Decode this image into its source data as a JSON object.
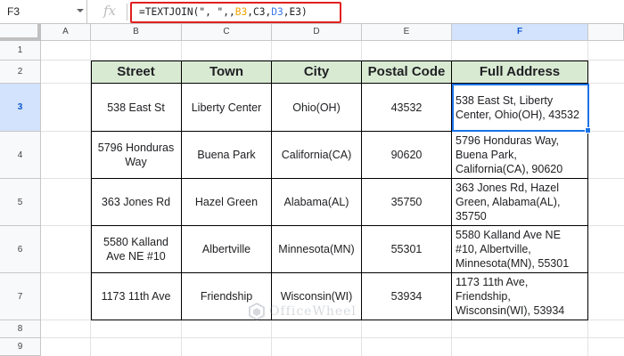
{
  "formula_bar": {
    "name_box": "F3",
    "fx_label": "fx",
    "formula_prefix": "=TEXTJOIN(\", \",,",
    "ref_b": "B3",
    "sep1": ",",
    "ref_c": "C3",
    "sep2": ",",
    "ref_d": "D3",
    "sep3": ",",
    "ref_e": "E3",
    "formula_suffix": ")"
  },
  "columns": [
    "A",
    "B",
    "C",
    "D",
    "E",
    "F"
  ],
  "rows": [
    "1",
    "2",
    "3",
    "4",
    "5",
    "6",
    "7",
    "8",
    "9"
  ],
  "selected_cell": {
    "column": "F",
    "row": "3"
  },
  "table": {
    "headers": [
      "Street",
      "Town",
      "City",
      "Postal Code",
      "Full Address"
    ],
    "data_rows": [
      [
        "538 East St",
        "Liberty Center",
        "Ohio(OH)",
        "43532",
        "538 East St, Liberty Center, Ohio(OH), 43532"
      ],
      [
        "5796 Honduras Way",
        "Buena Park",
        "California(CA)",
        "90620",
        "5796 Honduras Way, Buena Park, California(CA), 90620"
      ],
      [
        "363 Jones Rd",
        "Hazel Green",
        "Alabama(AL)",
        "35750",
        "363 Jones Rd, Hazel Green, Alabama(AL), 35750"
      ],
      [
        "5580 Kalland Ave NE #10",
        "Albertville",
        "Minnesota(MN)",
        "55301",
        "5580 Kalland Ave NE #10, Albertville, Minnesota(MN), 55301"
      ],
      [
        "1173 11th Ave",
        "Friendship",
        "Wisconsin(WI)",
        "53934",
        "1173 11th Ave, Friendship, Wisconsin(WI), 53934"
      ]
    ],
    "header_bg": "#d9ead3"
  },
  "watermark": {
    "text": "OfficeWheel"
  },
  "colors": {
    "selection": "#1a73e8",
    "formula_highlight_border": "#e02020"
  }
}
